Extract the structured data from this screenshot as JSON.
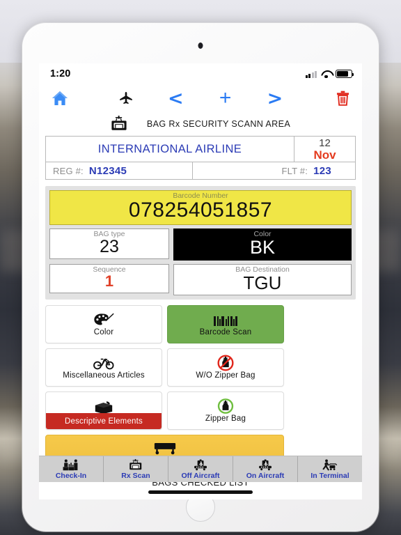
{
  "status_bar": {
    "time": "1:20",
    "signal_icon": "cellular-signal-icon",
    "wifi_icon": "wifi-icon",
    "battery_icon": "battery-icon"
  },
  "toolbar": {
    "items": [
      {
        "name": "home-icon",
        "label": ""
      },
      {
        "name": "airplane-icon",
        "label": ""
      },
      {
        "name": "previous-icon",
        "label": "<"
      },
      {
        "name": "add-icon",
        "label": "+"
      },
      {
        "name": "next-icon",
        "label": ">"
      },
      {
        "name": "delete-icon",
        "label": ""
      }
    ]
  },
  "page_title": {
    "icon": "xray-scanner-icon",
    "text": "BAG Rx SECURITY SCANN AREA"
  },
  "flight_header": {
    "airline": "INTERNATIONAL AIRLINE",
    "date_day": "12",
    "date_month": "Nov",
    "reg_label": "REG #:",
    "reg_value": "N12345",
    "flt_label": "FLT #:",
    "flt_value": "123"
  },
  "bag_panel": {
    "barcode_label": "Barcode Number",
    "barcode_value": "078254051857",
    "bagtype_label": "BAG type",
    "bagtype_value": "23",
    "color_label": "Color",
    "color_value": "BK",
    "sequence_label": "Sequence",
    "sequence_value": "1",
    "destination_label": "BAG Destination",
    "destination_value": "TGU"
  },
  "actions": [
    {
      "label": "Color",
      "icon": "paint-palette-icon",
      "style": "white"
    },
    {
      "label": "Barcode Scan",
      "icon": "barcode-icon",
      "style": "green"
    },
    {
      "label": "Miscellaneous Articles",
      "icon": "bicycle-icon",
      "style": "white"
    },
    {
      "label": "W/O Zipper Bag",
      "icon": "no-zipper-bag-icon",
      "style": "white"
    },
    {
      "label": "Descriptive Elements",
      "icon": "package-box-icon",
      "style": "white-red-banner"
    },
    {
      "label": "Zipper Bag",
      "icon": "zipper-bag-icon",
      "style": "white"
    },
    {
      "label": "Baggage Cart",
      "icon": "baggage-cart-icon",
      "style": "yellow"
    }
  ],
  "list_header": "BAGS CHECKED LIST",
  "tabs": [
    {
      "label": "Check-In",
      "icon": "check-in-counter-icon"
    },
    {
      "label": "Rx Scan",
      "icon": "xray-scanner-icon"
    },
    {
      "label": "Off Aircraft",
      "icon": "bag-off-aircraft-icon"
    },
    {
      "label": "On Aircraft",
      "icon": "bag-on-aircraft-icon"
    },
    {
      "label": "In Terminal",
      "icon": "porter-cart-icon"
    }
  ],
  "colors": {
    "accent_blue": "#2b7bf3",
    "label_blue": "#2b3bb5",
    "barcode_yellow": "#f0e646",
    "green": "#70ac4e",
    "red": "#c62a22",
    "yellow": "#f6c94a",
    "date_red": "#e43b1f"
  }
}
